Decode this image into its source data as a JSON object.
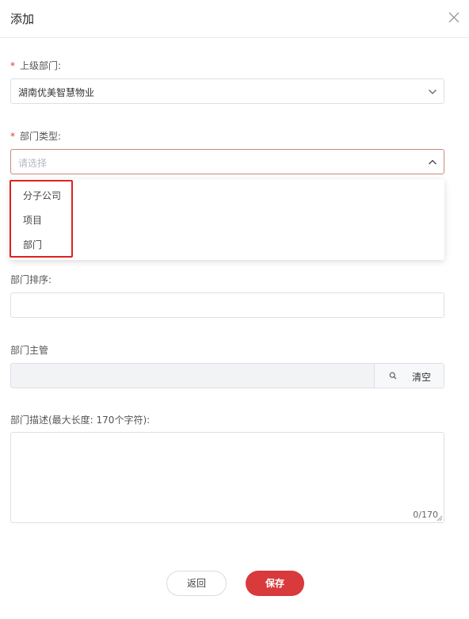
{
  "dialog": {
    "title": "添加"
  },
  "parent_dept": {
    "label": "上级部门:",
    "required": "*",
    "value": "湖南优美智慧物业"
  },
  "dept_type": {
    "label": "部门类型:",
    "required": "*",
    "placeholder": "请选择",
    "options": [
      "分子公司",
      "项目",
      "部门"
    ]
  },
  "dept_order": {
    "label": "部门排序:"
  },
  "dept_manager": {
    "label": "部门主管",
    "clear_label": "清空"
  },
  "dept_desc": {
    "label": "部门描述(最大长度: 170个字符):",
    "counter": "0/170"
  },
  "footer": {
    "back_label": "返回",
    "save_label": "保存"
  },
  "colors": {
    "accent": "#d93a3c",
    "highlight_box": "#e02020",
    "required": "#e0383e"
  }
}
